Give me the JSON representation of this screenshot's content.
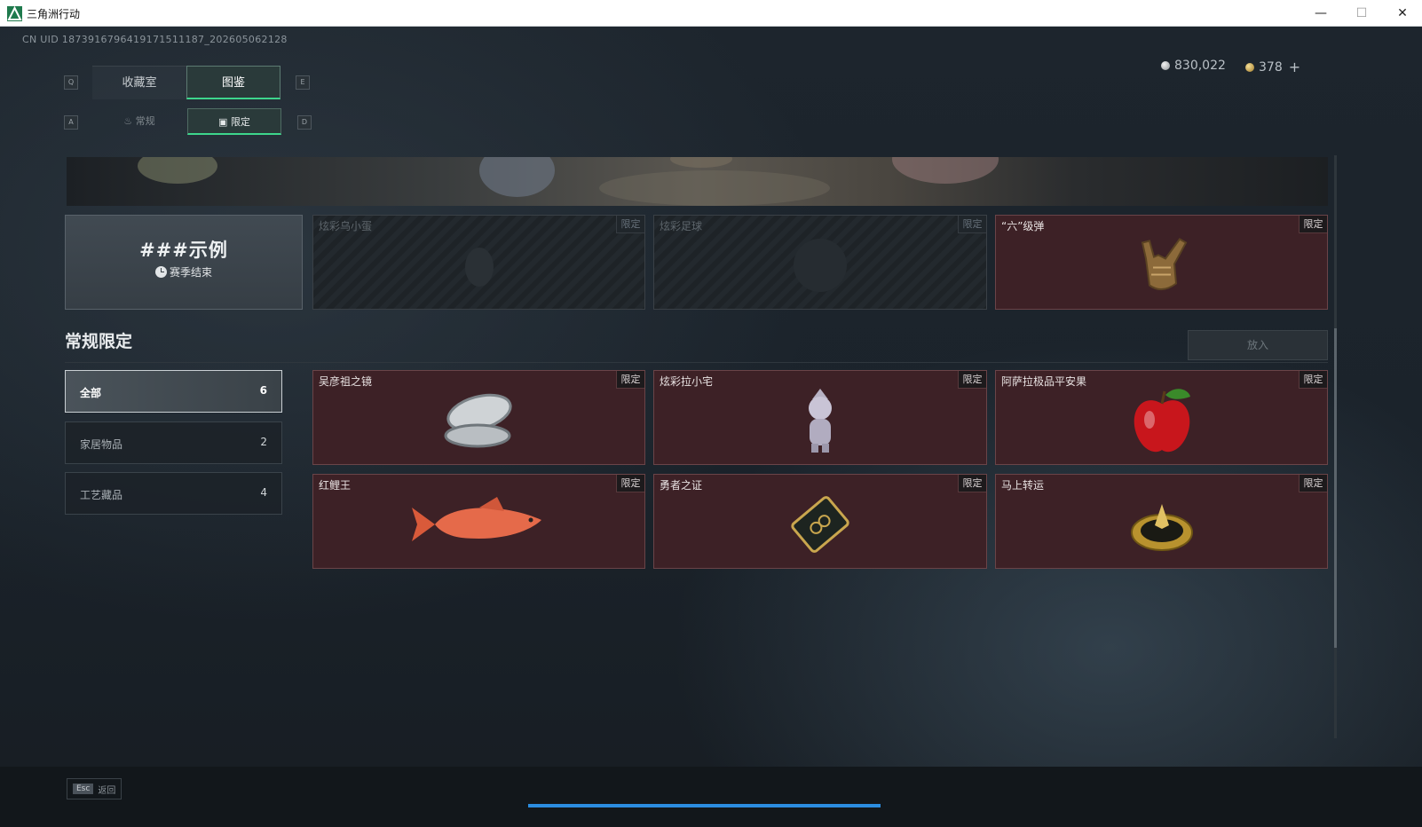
{
  "window": {
    "title": "三角洲行动"
  },
  "header": {
    "uid": "CN UID 1873916796419171511187_202605062128",
    "currency": [
      {
        "icon": "silver-coin-icon",
        "value": "830,022"
      },
      {
        "icon": "gold-coin-icon",
        "value": "378",
        "add": "+"
      }
    ]
  },
  "tabs": {
    "left_key": "Q",
    "right_key": "E",
    "items": [
      {
        "label": "收藏室",
        "active": false
      },
      {
        "label": "图鉴",
        "active": true
      }
    ]
  },
  "subtabs": {
    "left_key": "A",
    "right_key": "D",
    "items": [
      {
        "label": "常规",
        "icon": "flame-icon",
        "active": false
      },
      {
        "label": "限定",
        "icon": "image-icon",
        "active": true
      }
    ]
  },
  "featured": {
    "example": {
      "title": "###示例",
      "status": "赛季结束"
    },
    "cards": [
      {
        "name": "炫彩乌小蛋",
        "tag": "限定",
        "locked": true,
        "icon": "egg-icon"
      },
      {
        "name": "炫彩足球",
        "tag": "限定",
        "locked": true,
        "icon": "football-icon"
      },
      {
        "name": "“六”级弹",
        "tag": "限定",
        "locked": false,
        "icon": "hand-sign-icon"
      }
    ]
  },
  "section": {
    "title": "常规限定",
    "put_button": "放入"
  },
  "categories": [
    {
      "label": "全部",
      "count": "6",
      "active": true
    },
    {
      "label": "家居物品",
      "count": "2",
      "active": false
    },
    {
      "label": "工艺藏品",
      "count": "4",
      "active": false
    }
  ],
  "items": [
    {
      "name": "吴彦祖之镜",
      "tag": "限定",
      "icon": "mirror-icon"
    },
    {
      "name": "炫彩拉小宅",
      "tag": "限定",
      "icon": "figurine-icon"
    },
    {
      "name": "阿萨拉极品平安果",
      "tag": "限定",
      "icon": "apple-icon"
    },
    {
      "name": "红鲤王",
      "tag": "限定",
      "icon": "carp-icon"
    },
    {
      "name": "勇者之证",
      "tag": "限定",
      "icon": "medal-card-icon"
    },
    {
      "name": "马上转运",
      "tag": "限定",
      "icon": "golden-compass-icon"
    }
  ],
  "footer": {
    "esc_key": "Esc",
    "esc_label": "返回"
  }
}
